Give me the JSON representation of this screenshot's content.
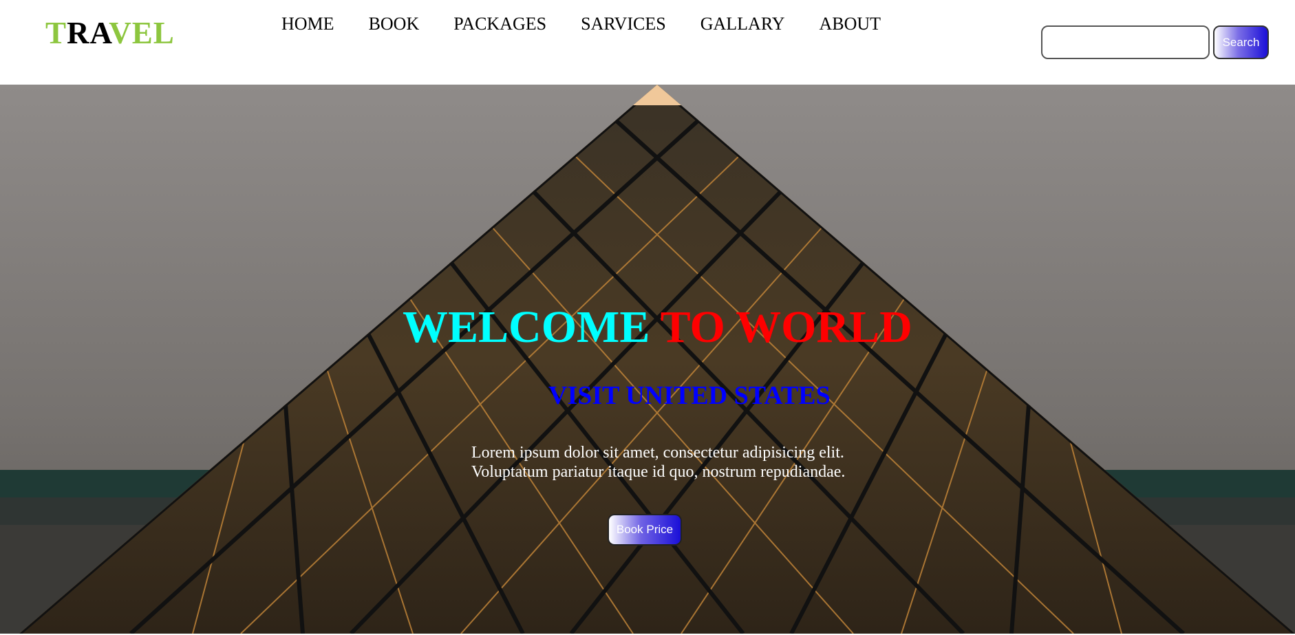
{
  "header": {
    "logo": {
      "part1": "T",
      "part2": "RA",
      "part3": "VEL"
    },
    "nav": [
      "HOME",
      "BOOK",
      "PACKAGES",
      "SARVICES",
      "GALLARY",
      "ABOUT"
    ],
    "search": {
      "value": "",
      "placeholder": "",
      "button_label": "Search"
    }
  },
  "hero": {
    "heading_part1": "WELCOME ",
    "heading_part2": "TO WORLD",
    "subheading": "VISIT UNITED STATES",
    "description_line1": "Lorem ipsum dolor sit amet, consectetur adipisicing elit.",
    "description_line2": "Voluptatum pariatur itaque id quo, nostrum repudiandae.",
    "button_label": "Book Price"
  },
  "colors": {
    "logo_green": "#8dc63f",
    "heading_cyan": "#00ffff",
    "heading_red": "#ff0000",
    "subheading_blue": "#0000ff",
    "button_gradient_end": "#1a0fd8"
  }
}
